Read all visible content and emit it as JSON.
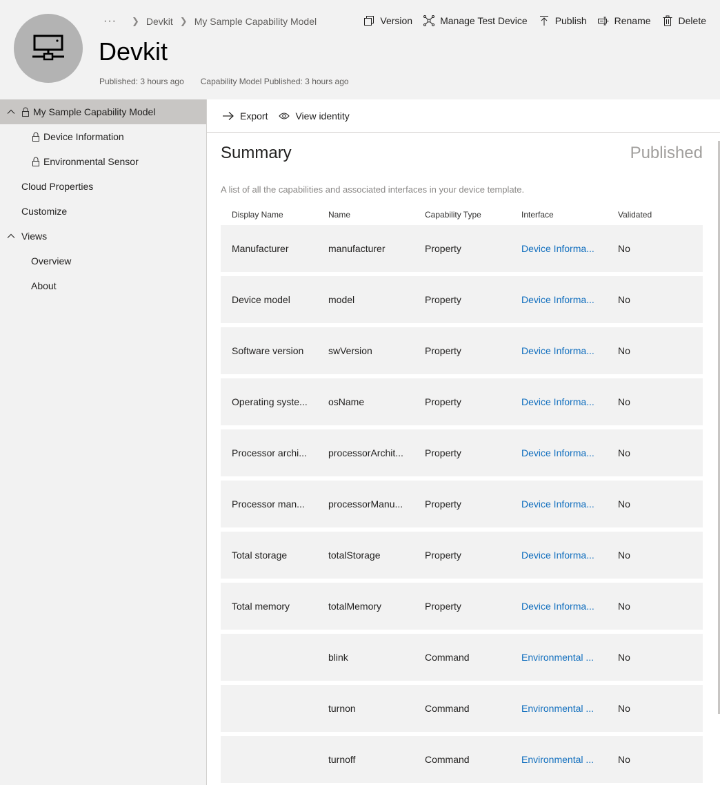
{
  "header": {
    "title": "Devkit",
    "breadcrumb": {
      "more": "···",
      "items": [
        "Devkit",
        "My Sample Capability Model"
      ]
    },
    "meta": {
      "published": "Published: 3 hours ago",
      "model_published": "Capability Model Published: 3 hours ago"
    },
    "actions": {
      "version": "Version",
      "manage_test_device": "Manage Test Device",
      "publish": "Publish",
      "rename": "Rename",
      "delete": "Delete"
    }
  },
  "sidebar": {
    "items": [
      {
        "label": "My Sample Capability Model"
      },
      {
        "label": "Device Information"
      },
      {
        "label": "Environmental Sensor"
      },
      {
        "label": "Cloud Properties"
      },
      {
        "label": "Customize"
      },
      {
        "label": "Views"
      },
      {
        "label": "Overview"
      },
      {
        "label": "About"
      }
    ]
  },
  "commands": {
    "export": "Export",
    "view_identity": "View identity"
  },
  "summary": {
    "title": "Summary",
    "status": "Published",
    "description": "A list of all the capabilities and associated interfaces in your device template.",
    "columns": [
      "Display Name",
      "Name",
      "Capability Type",
      "Interface",
      "Validated"
    ],
    "rows": [
      {
        "display": "Manufacturer",
        "name": "manufacturer",
        "type": "Property",
        "interface": "Device Informa...",
        "validated": "No"
      },
      {
        "display": "Device model",
        "name": "model",
        "type": "Property",
        "interface": "Device Informa...",
        "validated": "No"
      },
      {
        "display": "Software version",
        "name": "swVersion",
        "type": "Property",
        "interface": "Device Informa...",
        "validated": "No"
      },
      {
        "display": "Operating syste...",
        "name": "osName",
        "type": "Property",
        "interface": "Device Informa...",
        "validated": "No"
      },
      {
        "display": "Processor archi...",
        "name": "processorArchit...",
        "type": "Property",
        "interface": "Device Informa...",
        "validated": "No"
      },
      {
        "display": "Processor man...",
        "name": "processorManu...",
        "type": "Property",
        "interface": "Device Informa...",
        "validated": "No"
      },
      {
        "display": "Total storage",
        "name": "totalStorage",
        "type": "Property",
        "interface": "Device Informa...",
        "validated": "No"
      },
      {
        "display": "Total memory",
        "name": "totalMemory",
        "type": "Property",
        "interface": "Device Informa...",
        "validated": "No"
      },
      {
        "display": "",
        "name": "blink",
        "type": "Command",
        "interface": "Environmental ...",
        "validated": "No"
      },
      {
        "display": "",
        "name": "turnon",
        "type": "Command",
        "interface": "Environmental ...",
        "validated": "No"
      },
      {
        "display": "",
        "name": "turnoff",
        "type": "Command",
        "interface": "Environmental ...",
        "validated": "No"
      }
    ]
  }
}
